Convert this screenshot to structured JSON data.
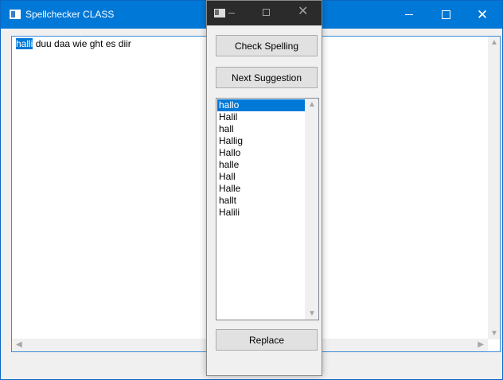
{
  "main_window": {
    "title": "Spellchecker CLASS",
    "editor": {
      "selected_word": "halli",
      "rest_text": " duu daa wie ght es diir"
    }
  },
  "dialog": {
    "check_label": "Check Spelling",
    "next_label": "Next Suggestion",
    "replace_label": "Replace",
    "suggestions": [
      "hallo",
      "Halil",
      "hall",
      "Hallig",
      "Hallo",
      "halle",
      "Hall",
      "Halle",
      "hallt",
      "Halili"
    ],
    "selected_index": 0
  },
  "colors": {
    "accent": "#0078d7",
    "dialog_title": "#2b2b2b"
  }
}
